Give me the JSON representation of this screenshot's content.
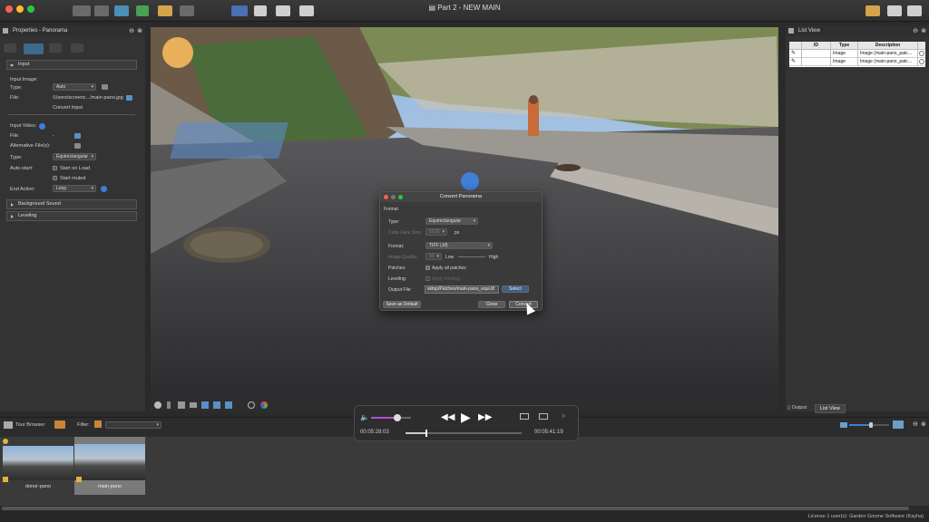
{
  "window": {
    "title": "Part 2 - NEW MAIN"
  },
  "properties": {
    "title": "Properties - Panorama",
    "sections": {
      "input": "Input",
      "background_sound": "Background Sound",
      "leveling": "Leveling"
    },
    "input_image_label": "Input Image:",
    "type_label": "Type:",
    "type_value": "Auto",
    "file_label": "File:",
    "file_value": "/Users/screenc.../main-pano.jpg",
    "convert_input": "Convert Input",
    "input_video_label": "Input Video:",
    "video_file_label": "File:",
    "video_file_value": "-",
    "alt_files_label": "Alternative File(s):",
    "video_type_label": "Type:",
    "video_type_value": "Equirectangular",
    "autostart_label": "Auto-start:",
    "start_on_load": "Start on Load",
    "start_muted": "Start muted",
    "end_action_label": "End Action:",
    "end_action_value": "Loop"
  },
  "dialog": {
    "title": "Convert Panorama",
    "section": "Format",
    "type_label": "Type:",
    "type_value": "Equirectangular",
    "cube_face_label": "Cube Face Size:",
    "cube_face_value": "5028",
    "px": "px",
    "format_label": "Format:",
    "format_value": "TIFF (.tif)",
    "quality_label": "Image Quality:",
    "quality_value": "90",
    "low": "Low",
    "high": "High",
    "patches_label": "Patches:",
    "apply_all_patches": "Apply all patches",
    "leveling_label": "Leveling:",
    "apply_leveling": "Apply leveling",
    "output_label": "Output File:",
    "output_value": "sktop/Patches/main-pano_equi.tif",
    "select": "Select",
    "save_default": "Save as Default",
    "close": "Close",
    "convert": "Convert"
  },
  "listview": {
    "title": "List View",
    "columns": [
      "ID",
      "Type",
      "Description"
    ],
    "rows": [
      {
        "id": "",
        "type": "Image",
        "description": "Image (main-pano_patc..."
      },
      {
        "id": "",
        "type": "Image",
        "description": "Image (main-pano_patc..."
      }
    ],
    "tabs": [
      "Output",
      "List View"
    ]
  },
  "media": {
    "progress": 0.17,
    "current_time": "00:05:28:03",
    "total_time": "00:05:41:19",
    "volume": 0.65
  },
  "tour_browser": {
    "title": "Tour Browser",
    "filter_label": "Filter:",
    "items": [
      {
        "name": "donor-pano"
      },
      {
        "name": "main-pano"
      }
    ]
  },
  "status": {
    "text": "License 1 user(s): Garden Gnome Software (Kayha)"
  },
  "colors": {
    "accent": "#b04fd6",
    "dialog_bg": "#3a3a3a",
    "panel_bg": "#333333"
  }
}
